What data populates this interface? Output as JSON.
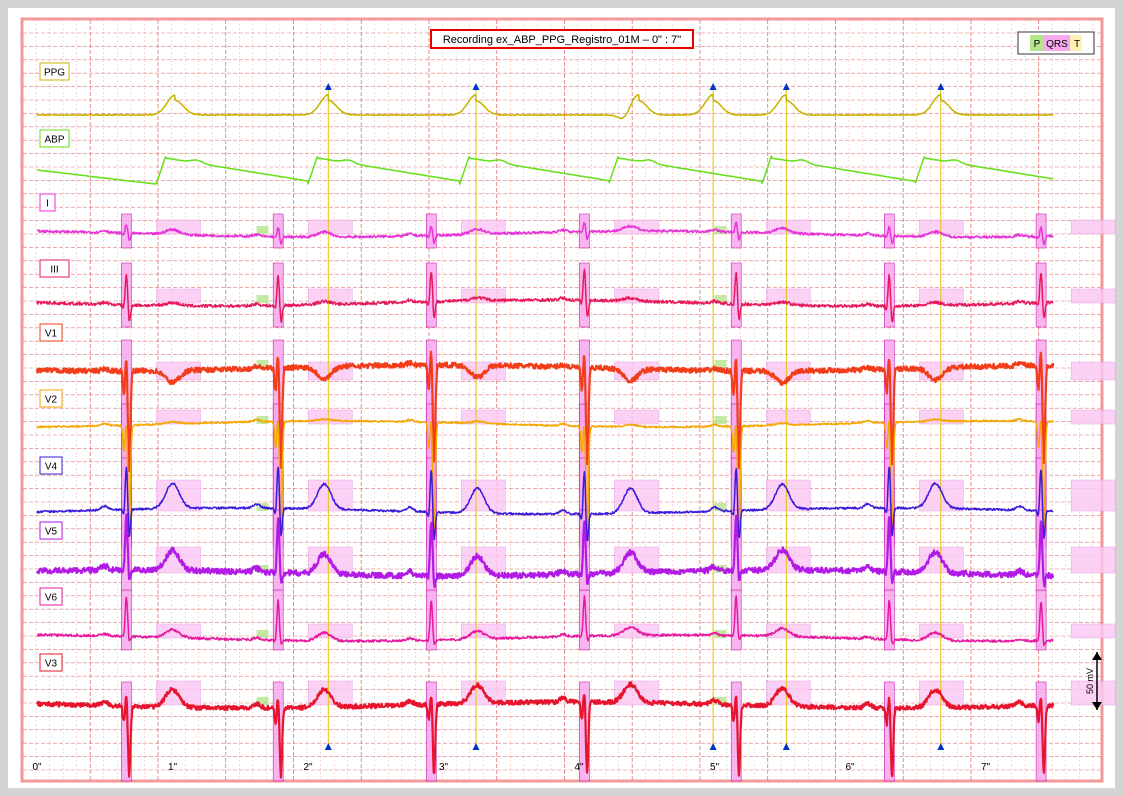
{
  "title": "Recording ex_ABP_PPG_Registro_01M – 0\" : 7\"",
  "legend": {
    "p": "P",
    "qrs": "QRS",
    "t": "T"
  },
  "scale_label": "50 mV",
  "colors": {
    "grid_major": "#e07474",
    "grid_minor": "#f2b5b5",
    "border": "#f29a9a",
    "title_border": "#e60000",
    "p_wave": "#9ad76a",
    "qrs": "#ff66cc",
    "t_wave": "#ffd9f2",
    "marker": "#0033cc",
    "marker_line": "#e6c400"
  },
  "chart_data": {
    "type": "line",
    "title": "Recording ex_ABP_PPG_Registro_01M – 0\" : 7\"",
    "x_unit": "s",
    "xlim": [
      0,
      7.5
    ],
    "x_ticks": [
      {
        "value": 0,
        "label": "0\""
      },
      {
        "value": 1,
        "label": "1\""
      },
      {
        "value": 2,
        "label": "2\""
      },
      {
        "value": 3,
        "label": "3\""
      },
      {
        "value": 4,
        "label": "4\""
      },
      {
        "value": 5,
        "label": "5\""
      },
      {
        "value": 6,
        "label": "6\""
      },
      {
        "value": 7,
        "label": "7\""
      }
    ],
    "grid": true,
    "legend_position": "top-right",
    "qrs_times": [
      0.66,
      1.78,
      2.91,
      4.04,
      5.16,
      6.29,
      7.41
    ],
    "ppg_markers": [
      2.15,
      3.24,
      4.99,
      5.53,
      6.67
    ],
    "abp_upstrokes": [
      0.88,
      2.0,
      3.12,
      4.22,
      5.35,
      6.48,
      7.55
    ],
    "series": [
      {
        "name": "PPG",
        "color": "#c8b400",
        "kind": "ppg",
        "amplitude": 16,
        "noise": 0.8
      },
      {
        "name": "ABP",
        "color": "#66e01a",
        "kind": "abp",
        "amplitude": 28,
        "noise": 0.4
      },
      {
        "name": "I",
        "color": "#e633d6",
        "kind": "ecg",
        "r": 10,
        "s": -8,
        "t": 5,
        "p": 1,
        "noise": 1.2
      },
      {
        "name": "III",
        "color": "#e61a5a",
        "kind": "ecg",
        "r": 32,
        "s": -18,
        "t": 3,
        "p": 1,
        "noise": 1.5
      },
      {
        "name": "V1",
        "color": "#f23d1a",
        "kind": "ecg",
        "r": 20,
        "s": -100,
        "t": -12,
        "p": 1,
        "noise": 2.5
      },
      {
        "name": "V2",
        "color": "#f5a600",
        "kind": "ecg",
        "r": 10,
        "s": -110,
        "t": 2,
        "p": 1,
        "noise": 0.8
      },
      {
        "name": "V4",
        "color": "#3b1ad9",
        "kind": "ecg",
        "r": 45,
        "s": -30,
        "t": 25,
        "p": 2,
        "noise": 1.0
      },
      {
        "name": "V5",
        "color": "#b21ae6",
        "kind": "ecg",
        "r": 55,
        "s": -12,
        "t": 20,
        "p": 2,
        "noise": 2.8
      },
      {
        "name": "V6",
        "color": "#e6199e",
        "kind": "ecg",
        "r": 40,
        "s": -6,
        "t": 8,
        "p": 1,
        "noise": 1.2
      },
      {
        "name": "V3",
        "color": "#e6142d",
        "kind": "ecg",
        "r": 15,
        "s": -70,
        "t": 18,
        "p": 2,
        "noise": 2.2
      }
    ]
  }
}
